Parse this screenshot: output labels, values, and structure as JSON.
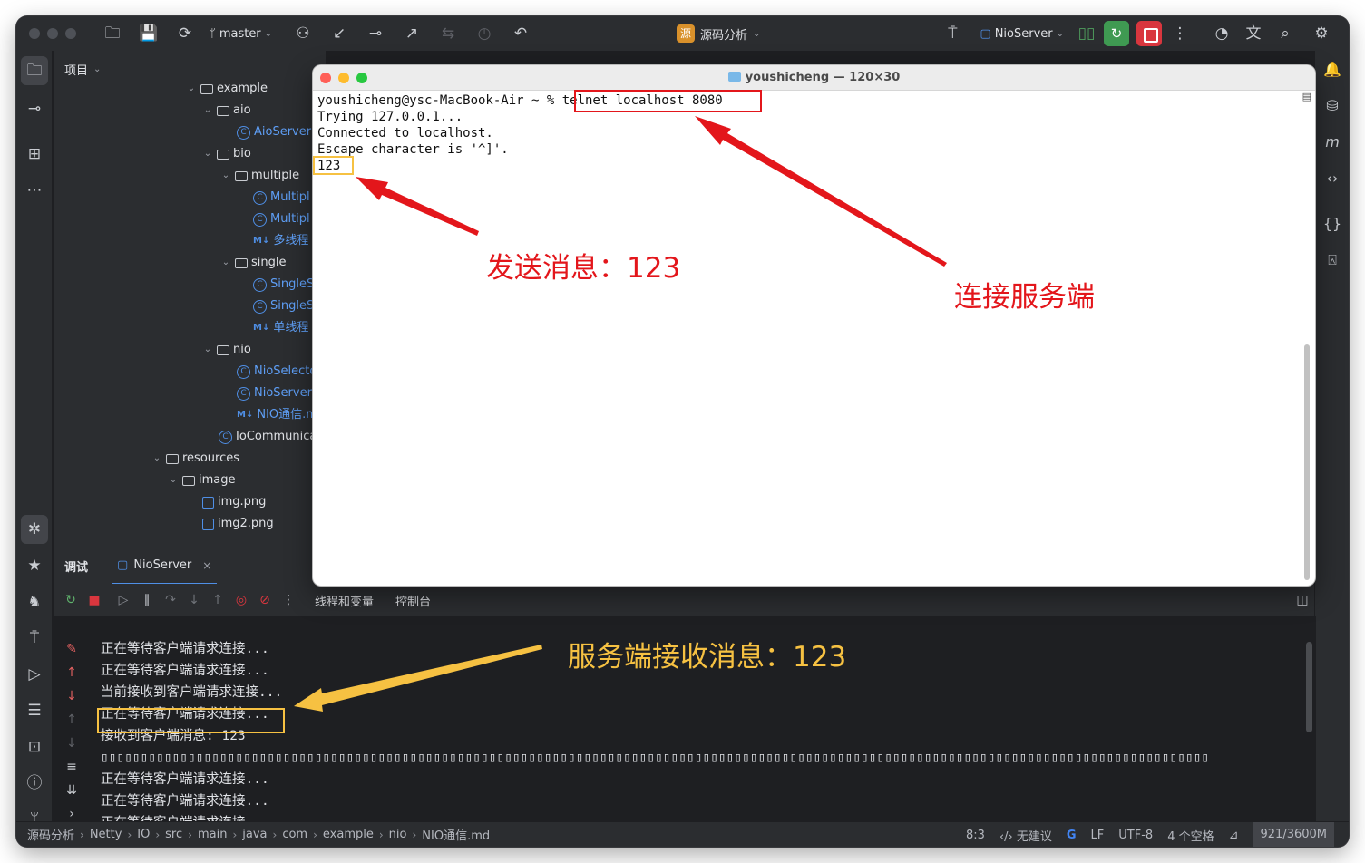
{
  "titlebar": {
    "branch": "master",
    "project": "源码分析",
    "project_badge": "源",
    "run_config": "NioServer"
  },
  "project_panel": {
    "title": "项目",
    "tree": [
      {
        "label": "example",
        "kind": "folder",
        "expanded": true
      },
      {
        "label": "aio",
        "kind": "folder",
        "expanded": true
      },
      {
        "label": "AioServer",
        "kind": "class"
      },
      {
        "label": "bio",
        "kind": "folder",
        "expanded": true
      },
      {
        "label": "multiple",
        "kind": "folder",
        "expanded": true
      },
      {
        "label": "Multipl",
        "kind": "class"
      },
      {
        "label": "Multipl",
        "kind": "class"
      },
      {
        "label": "多线程",
        "kind": "markdown"
      },
      {
        "label": "single",
        "kind": "folder",
        "expanded": true
      },
      {
        "label": "SingleS",
        "kind": "class"
      },
      {
        "label": "SingleS",
        "kind": "class"
      },
      {
        "label": "单线程",
        "kind": "markdown"
      },
      {
        "label": "nio",
        "kind": "folder",
        "expanded": true
      },
      {
        "label": "NioSelecto",
        "kind": "class"
      },
      {
        "label": "NioServer",
        "kind": "class"
      },
      {
        "label": "NIO通信.m",
        "kind": "markdown"
      },
      {
        "label": "IoCommunica",
        "kind": "class"
      },
      {
        "label": "resources",
        "kind": "folder",
        "expanded": true
      },
      {
        "label": "image",
        "kind": "folder",
        "expanded": true
      },
      {
        "label": "img.png",
        "kind": "image"
      },
      {
        "label": "img2.png",
        "kind": "image"
      }
    ]
  },
  "terminal": {
    "window_title": "youshicheng — 120×30",
    "prompt": "youshicheng@ysc-MacBook-Air ~ % ",
    "command": "telnet localhost 8080",
    "lines": [
      "Trying 127.0.0.1...",
      "Connected to localhost.",
      "Escape character is '^]'.",
      "123"
    ]
  },
  "debug": {
    "panel_label": "调试",
    "session_tab": "NioServer",
    "tabs": [
      "线程和变量",
      "控制台"
    ],
    "console_lines": [
      "正在等待客户端请求连接...",
      "正在等待客户端请求连接...",
      "当前接收到客户端请求连接...",
      "正在等待客户端请求连接...",
      "接收到客户端消息: 123",
      "▯▯▯▯▯▯▯▯▯▯▯▯▯▯▯▯▯▯▯▯▯▯▯▯▯▯▯▯▯▯▯▯▯▯▯▯▯▯▯▯▯▯▯▯▯▯▯▯▯▯▯▯▯▯▯▯▯▯▯▯▯▯▯▯▯▯▯▯▯▯▯▯▯▯▯▯▯▯▯▯▯▯▯▯▯▯▯▯▯▯▯▯▯▯▯▯▯▯▯▯▯▯▯▯▯▯▯▯▯▯▯▯▯▯▯▯▯▯▯▯▯▯▯▯▯▯▯▯▯▯▯▯▯▯▯▯▯▯▯▯",
      "正在等待客户端请求连接...",
      "正在等待客户端请求连接...",
      "正在等待客户端请求连接..."
    ]
  },
  "statusbar": {
    "breadcrumbs": [
      "源码分析",
      "Netty",
      "IO",
      "src",
      "main",
      "java",
      "com",
      "example",
      "nio",
      "NIO通信.md"
    ],
    "position": "8:3",
    "ai_status": "无建议",
    "line_sep": "LF",
    "encoding": "UTF-8",
    "indent": "4 个空格",
    "memory": "921/3600M"
  },
  "annotations": {
    "send_message": "发送消息：123",
    "connect_server": "连接服务端",
    "server_receive": "服务端接收消息：123"
  },
  "colors": {
    "annotation_red": "#e3161b",
    "annotation_yellow": "#f6c142",
    "ide_background": "#1e1f22",
    "ide_panel": "#2b2d30",
    "accent_blue": "#4f8fe6"
  }
}
